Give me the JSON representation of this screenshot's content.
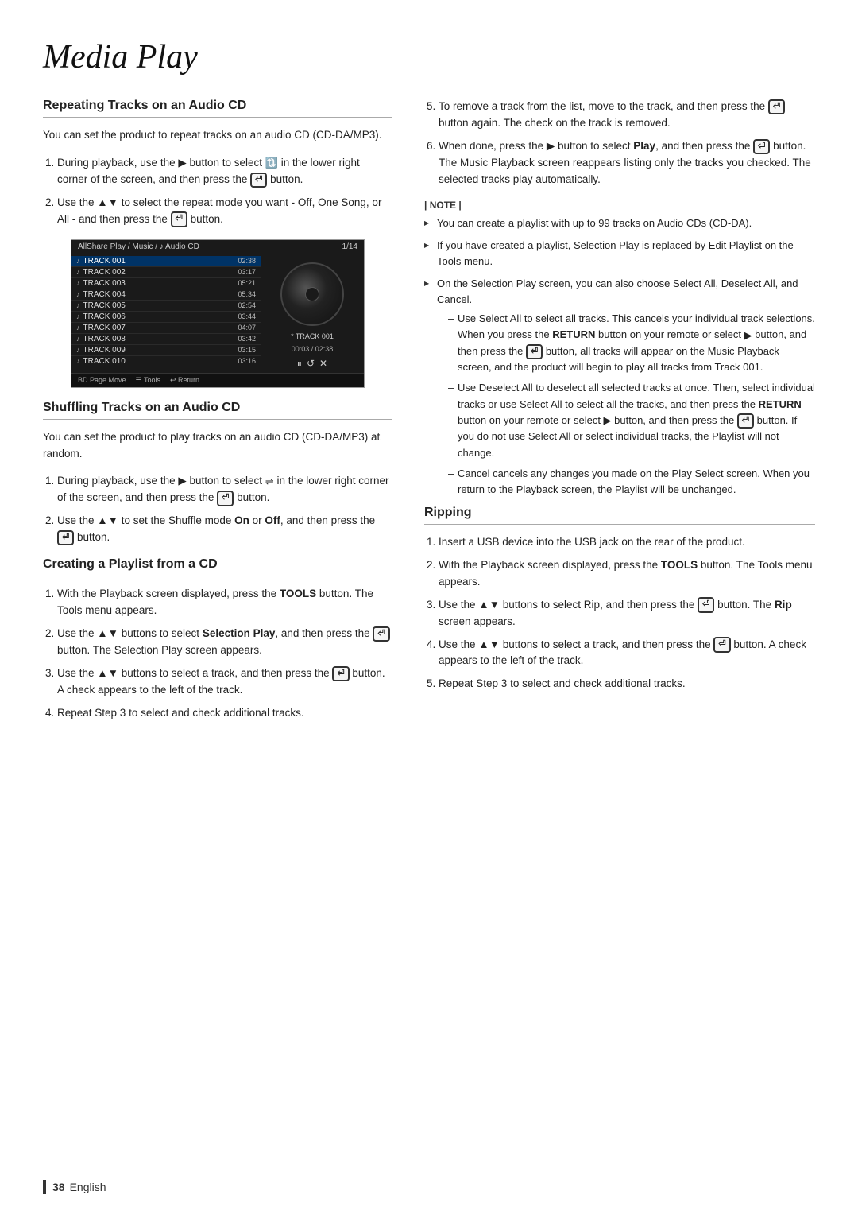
{
  "page": {
    "title": "Media Play",
    "page_number": "38",
    "language": "English"
  },
  "left_col": {
    "section1": {
      "title": "Repeating Tracks on an Audio CD",
      "intro": "You can set the product to repeat tracks on an audio CD (CD-DA/MP3).",
      "steps": [
        "During playback, use the ▶ button to select  in the lower right corner of the screen, and then press the  button.",
        "Use the ▲▼ to select the repeat mode you want - Off, One Song, or All - and then press the  button."
      ]
    },
    "cd_screenshot": {
      "topbar_left": "AllShare Play / Music /  Audio CD",
      "topbar_right": "1/14",
      "tracks": [
        {
          "name": "TRACK 001",
          "time": "02:38",
          "active": true
        },
        {
          "name": "TRACK 002",
          "time": "03:17",
          "active": false
        },
        {
          "name": "TRACK 003",
          "time": "05:21",
          "active": false
        },
        {
          "name": "TRACK 004",
          "time": "05:34",
          "active": false
        },
        {
          "name": "TRACK 005",
          "time": "02:54",
          "active": false
        },
        {
          "name": "TRACK 006",
          "time": "03:44",
          "active": false
        },
        {
          "name": "TRACK 007",
          "time": "04:07",
          "active": false
        },
        {
          "name": "TRACK 008",
          "time": "03:42",
          "active": false
        },
        {
          "name": "TRACK 009",
          "time": "03:15",
          "active": false
        },
        {
          "name": "TRACK 010",
          "time": "03:16",
          "active": false
        }
      ],
      "track_label": "* TRACK 001",
      "time_display": "00:03 / 02:38",
      "controls": "⏸ ↺ ✕",
      "bottombar": "BD  Page Move    Tools    Return"
    },
    "section2": {
      "title": "Shuffling Tracks on an Audio CD",
      "intro": "You can set the product to play tracks on an audio CD (CD-DA/MP3) at random.",
      "steps": [
        "During playback, use the ▶ button to select  in the lower right corner of the screen, and then press the  button.",
        "Use the ▲▼ to set the Shuffle mode On or Off, and then press the  button."
      ]
    },
    "section3": {
      "title": "Creating a Playlist from a CD",
      "steps": [
        "With the Playback screen displayed, press the TOOLS button. The Tools menu appears.",
        "Use the ▲▼ buttons to select Selection Play, and then press the  button. The Selection Play screen appears.",
        "Use the ▲▼ buttons to select a track, and then press the  button. A check appears to the left of the track.",
        "Repeat Step 3 to select and check additional tracks."
      ]
    }
  },
  "right_col": {
    "steps_cont": [
      "To remove a track from the list, move to the track, and then press the  button again. The check on the track is removed.",
      "When done, press the ▶ button to select Play, and then press the  button. The Music Playback screen reappears listing only the tracks you checked. The selected tracks play automatically."
    ],
    "note": {
      "header": "| NOTE |",
      "items": [
        "You can create a playlist with up to 99 tracks on Audio CDs (CD-DA).",
        "If you have created a playlist, Selection Play is replaced by Edit Playlist on the Tools menu.",
        "On the Selection Play screen, you can also choose Select All, Deselect All, and Cancel.",
        "Use Select All to select all tracks _ cancels your"
      ],
      "sub_items": [
        {
          "label": "Use Select All",
          "text": "Use Select All to select all tracks. This cancels your individual track selections. When you press the RETURN button on your remote or select  button, and then press the  button, all tracks will appear on the Music Playback screen, and the product will begin to play all tracks from Track 001."
        },
        {
          "label": "Use Deselect All",
          "text": "Use Deselect All to deselect all selected tracks at once. Then, select individual tracks or use Select All to select all the tracks, and then press the RETURN button on your remote or select  button, and then press the  button. If you do not use Select All or select individual tracks, the Playlist will not change."
        },
        {
          "label": "Cancel",
          "text": "Cancel cancels any changes you made on the Play Select screen. When you return to the Playback screen, the Playlist will be unchanged."
        }
      ]
    },
    "section_ripping": {
      "title": "Ripping",
      "steps": [
        "Insert a USB device into the USB jack on the rear of the product.",
        "With the Playback screen displayed, press the TOOLS button. The Tools menu appears.",
        "Use the ▲▼ buttons to select Rip, and then press the  button. The Rip screen appears.",
        "Use the ▲▼ buttons to select a track, and then press the  button. A check appears to the left of the track.",
        "Repeat Step 3 to select and check additional tracks."
      ]
    }
  }
}
